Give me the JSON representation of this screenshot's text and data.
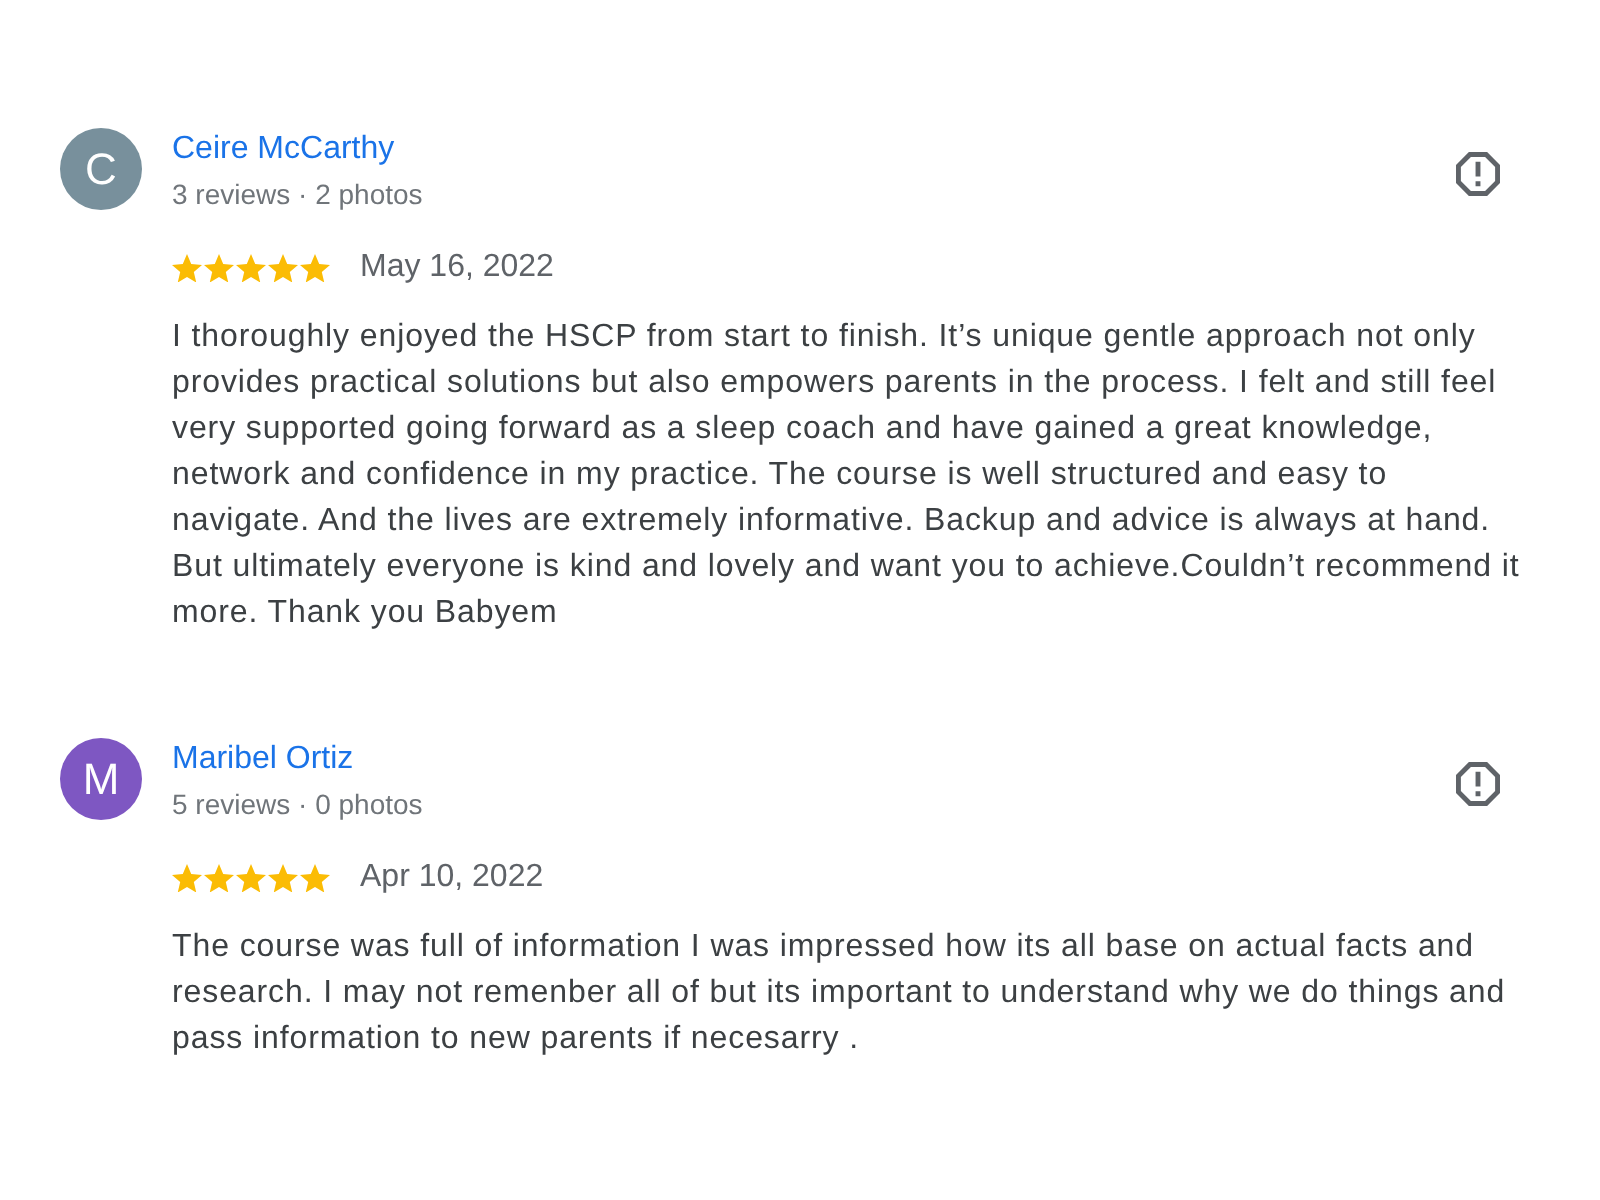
{
  "reviews": [
    {
      "avatar": {
        "letter": "C",
        "color": "#78909c"
      },
      "name": "Ceire McCarthy",
      "meta": "3 reviews · 2 photos",
      "stars": 5,
      "date": "May 16, 2022",
      "text": "I thoroughly enjoyed the HSCP from start to finish. It’s unique gentle approach not only provides practical solutions but also empowers parents in the process. I felt and still feel very supported going forward as a sleep coach and have gained a great knowledge, network and confidence in my practice. The course is well structured and easy to navigate. And the lives are extremely informative. Backup and advice is always at hand. But ultimately everyone is kind and lovely and want you to achieve.Couldn’t recommend it more. Thank you Babyem"
    },
    {
      "avatar": {
        "letter": "M",
        "color": "#7e57c2"
      },
      "name": "Maribel Ortiz",
      "meta": "5 reviews · 0 photos",
      "stars": 5,
      "date": "Apr 10, 2022",
      "text": "The course was full of information I was impressed how its all base on actual facts and research. I may not remenber all of but its important to understand why we do things and pass information to new parents if necesarry ."
    }
  ]
}
